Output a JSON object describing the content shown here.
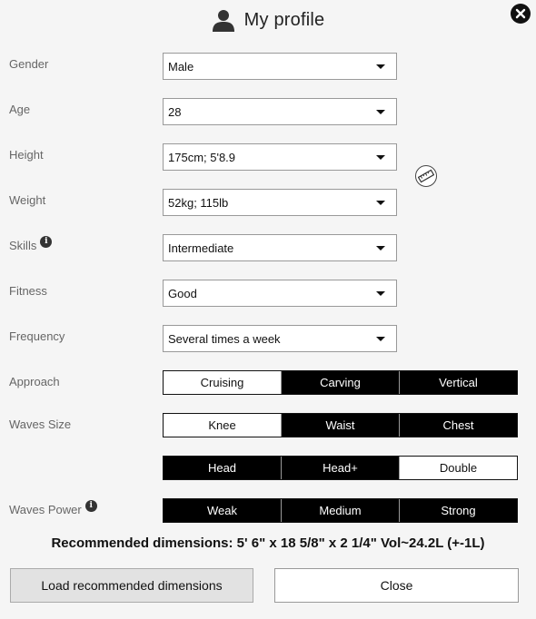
{
  "header": {
    "title": "My profile",
    "user_icon": "user-icon",
    "close_icon": "close-icon"
  },
  "fields": {
    "gender": {
      "label": "Gender",
      "value": "Male"
    },
    "age": {
      "label": "Age",
      "value": "28"
    },
    "height": {
      "label": "Height",
      "value": "175cm; 5'8.9"
    },
    "weight": {
      "label": "Weight",
      "value": "52kg; 115lb"
    },
    "skills": {
      "label": "Skills",
      "value": "Intermediate"
    },
    "fitness": {
      "label": "Fitness",
      "value": "Good"
    },
    "frequency": {
      "label": "Frequency",
      "value": "Several times a week"
    }
  },
  "approach": {
    "label": "Approach",
    "options": [
      "Cruising",
      "Carving",
      "Vertical"
    ],
    "selected": [
      false,
      true,
      true
    ]
  },
  "waves_size": {
    "label": "Waves Size",
    "options": [
      "Knee",
      "Waist",
      "Chest",
      "Head",
      "Head+",
      "Double"
    ],
    "selected": [
      false,
      true,
      true,
      true,
      true,
      false
    ]
  },
  "waves_power": {
    "label": "Waves Power",
    "options": [
      "Weak",
      "Medium",
      "Strong"
    ],
    "selected": [
      true,
      true,
      true
    ]
  },
  "recommended": "Recommended dimensions: 5' 6\" x 18 5/8\" x 2 1/4\" Vol~24.2L (+-1L)",
  "buttons": {
    "load": "Load recommended dimensions",
    "close": "Close"
  },
  "icons": {
    "info": "info-icon",
    "ruler": "ruler-icon"
  },
  "colors": {
    "selected_bg": "#000000",
    "unselected_bg": "#ffffff",
    "page_bg": "#f5f5f5"
  }
}
